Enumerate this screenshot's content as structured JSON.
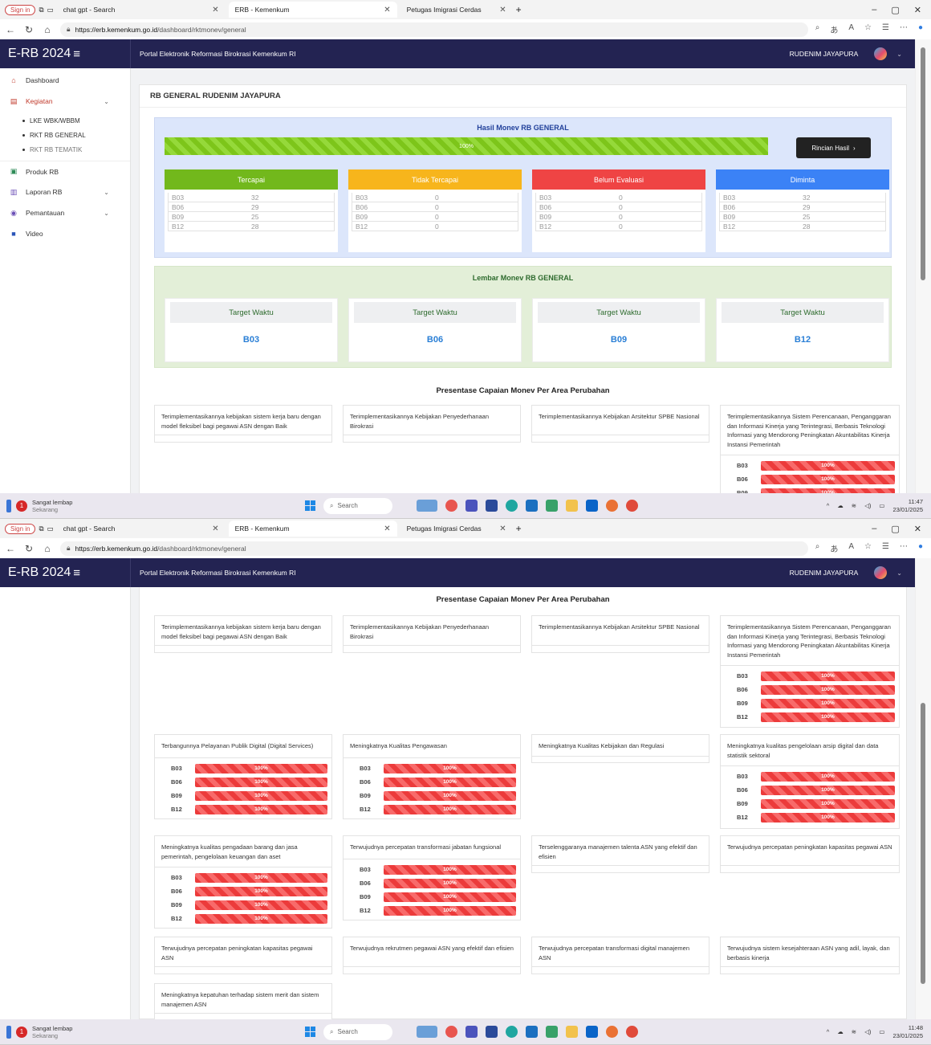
{
  "browser": {
    "signin": "Sign in",
    "tabs": [
      {
        "title": "chat gpt - Search",
        "active": false
      },
      {
        "title": "ERB - Kemenkum",
        "active": true
      },
      {
        "title": "Petugas Imigrasi Cerdas",
        "active": false
      }
    ],
    "url_domain": "https://erb.kemenkum.go.id",
    "url_path": "/dashboard/rktmonev/general"
  },
  "app": {
    "brand": "E-RB 2024",
    "portal": "Portal Elektronik Reformasi Birokrasi Kemenkum RI",
    "user": "RUDENIM JAYAPURA"
  },
  "sidebar": {
    "items": [
      {
        "label": "Dashboard",
        "icon": "home-icon"
      },
      {
        "label": "Kegiatan",
        "icon": "calendar-icon",
        "expanded": true
      },
      {
        "label": "Produk RB",
        "icon": "file-icon"
      },
      {
        "label": "Laporan RB",
        "icon": "report-icon"
      },
      {
        "label": "Pemantauan",
        "icon": "eye-icon"
      },
      {
        "label": "Video",
        "icon": "video-icon"
      }
    ],
    "subitems": [
      "LKE WBK/WBBM",
      "RKT RB GENERAL",
      "RKT RB TEMATIK"
    ]
  },
  "page": {
    "title": "RB GENERAL RUDENIM JAYAPURA",
    "hasil_title": "Hasil Monev RB GENERAL",
    "hasil_progress_label": "100%",
    "hasil_progress": 1.0,
    "rincian_button": "Rincian Hasil",
    "status_boxes": [
      {
        "title": "Tercapai",
        "color": "#72b81c",
        "rows": [
          [
            "B03",
            "32"
          ],
          [
            "B06",
            "29"
          ],
          [
            "B09",
            "25"
          ],
          [
            "B12",
            "28"
          ]
        ]
      },
      {
        "title": "Tidak Tercapai",
        "color": "#f7b51c",
        "rows": [
          [
            "B03",
            "0"
          ],
          [
            "B06",
            "0"
          ],
          [
            "B09",
            "0"
          ],
          [
            "B12",
            "0"
          ]
        ]
      },
      {
        "title": "Belum Evaluasi",
        "color": "#ef4444",
        "rows": [
          [
            "B03",
            "0"
          ],
          [
            "B06",
            "0"
          ],
          [
            "B09",
            "0"
          ],
          [
            "B12",
            "0"
          ]
        ]
      },
      {
        "title": "Diminta",
        "color": "#3b82f6",
        "rows": [
          [
            "B03",
            "32"
          ],
          [
            "B06",
            "29"
          ],
          [
            "B09",
            "25"
          ],
          [
            "B12",
            "28"
          ]
        ]
      }
    ],
    "lembar_title": "Lembar Monev RB GENERAL",
    "target_boxes": [
      {
        "label": "Target Waktu",
        "value": "B03"
      },
      {
        "label": "Target Waktu",
        "value": "B06"
      },
      {
        "label": "Target Waktu",
        "value": "B09"
      },
      {
        "label": "Target Waktu",
        "value": "B12"
      }
    ],
    "presentase_title": "Presentase Capaian Monev Per Area Perubahan"
  },
  "areas": [
    {
      "title": "Terimplementasikannya kebijakan sistem kerja baru dengan model fleksibel bagi pegawai ASN dengan Baik",
      "bars": []
    },
    {
      "title": "Terimplementasikannya Kebijakan Penyederhanaan Birokrasi",
      "bars": []
    },
    {
      "title": "Terimplementasikannya Kebijakan Arsitektur SPBE Nasional",
      "bars": []
    },
    {
      "title": "Terimplementasikannya Sistem Perencanaan, Penganggaran dan Informasi Kinerja yang Terintegrasi, Berbasis Teknologi Informasi yang Mendorong Peningkatan Akuntabilitas Kinerja Instansi Pemerintah",
      "bars": [
        [
          "B03",
          "100%"
        ],
        [
          "B06",
          "100%"
        ],
        [
          "B09",
          "100%"
        ],
        [
          "B12",
          "100%"
        ]
      ]
    },
    {
      "title": "Terbangunnya Pelayanan Publik Digital (Digital Services)",
      "bars": [
        [
          "B03",
          "100%"
        ],
        [
          "B06",
          "100%"
        ],
        [
          "B09",
          "100%"
        ],
        [
          "B12",
          "100%"
        ]
      ]
    },
    {
      "title": "Meningkatnya Kualitas Pengawasan",
      "bars": [
        [
          "B03",
          "100%"
        ],
        [
          "B06",
          "100%"
        ],
        [
          "B09",
          "100%"
        ],
        [
          "B12",
          "100%"
        ]
      ]
    },
    {
      "title": "Meningkatnya Kualitas Kebijakan dan Regulasi",
      "bars": []
    },
    {
      "title": "Meningkatnya kualitas pengelolaan arsip digital dan data statistik sektoral",
      "bars": [
        [
          "B03",
          "100%"
        ],
        [
          "B06",
          "100%"
        ],
        [
          "B09",
          "100%"
        ],
        [
          "B12",
          "100%"
        ]
      ]
    },
    {
      "title": "Meningkatnya kualitas pengadaan barang dan jasa pemerintah, pengelolaan keuangan dan aset",
      "bars": [
        [
          "B03",
          "100%"
        ],
        [
          "B06",
          "100%"
        ],
        [
          "B09",
          "100%"
        ],
        [
          "B12",
          "100%"
        ]
      ]
    },
    {
      "title": "Terwujudnya percepatan transformasi jabatan fungsional",
      "bars": [
        [
          "B03",
          "100%"
        ],
        [
          "B06",
          "100%"
        ],
        [
          "B09",
          "100%"
        ],
        [
          "B12",
          "100%"
        ]
      ]
    },
    {
      "title": "Terselenggaranya manajemen talenta ASN yang efektif dan efisien",
      "bars": []
    },
    {
      "title": "Terwujudnya percepatan peningkatan kapasitas pegawai ASN",
      "bars": []
    },
    {
      "title": "Terwujudnya percepatan peningkatan kapasitas pegawai ASN",
      "bars": []
    },
    {
      "title": "Terwujudnya rekrutmen pegawai ASN yang efektif dan efisien",
      "bars": []
    },
    {
      "title": "Terwujudnya percepatan transformasi digital manajemen ASN",
      "bars": []
    },
    {
      "title": "Terwujudnya sistem kesejahteraan ASN yang adil, layak, dan berbasis kinerja",
      "bars": []
    },
    {
      "title": "Meningkatnya kepatuhan terhadap sistem merit dan sistem manajemen ASN",
      "bars": []
    }
  ],
  "taskbar": {
    "notif_count": "1",
    "notif_title": "Sangat lembap",
    "notif_sub": "Sekarang",
    "search": "Search",
    "date": "23/01/2025",
    "time1": "11:47",
    "time2": "11:48"
  }
}
